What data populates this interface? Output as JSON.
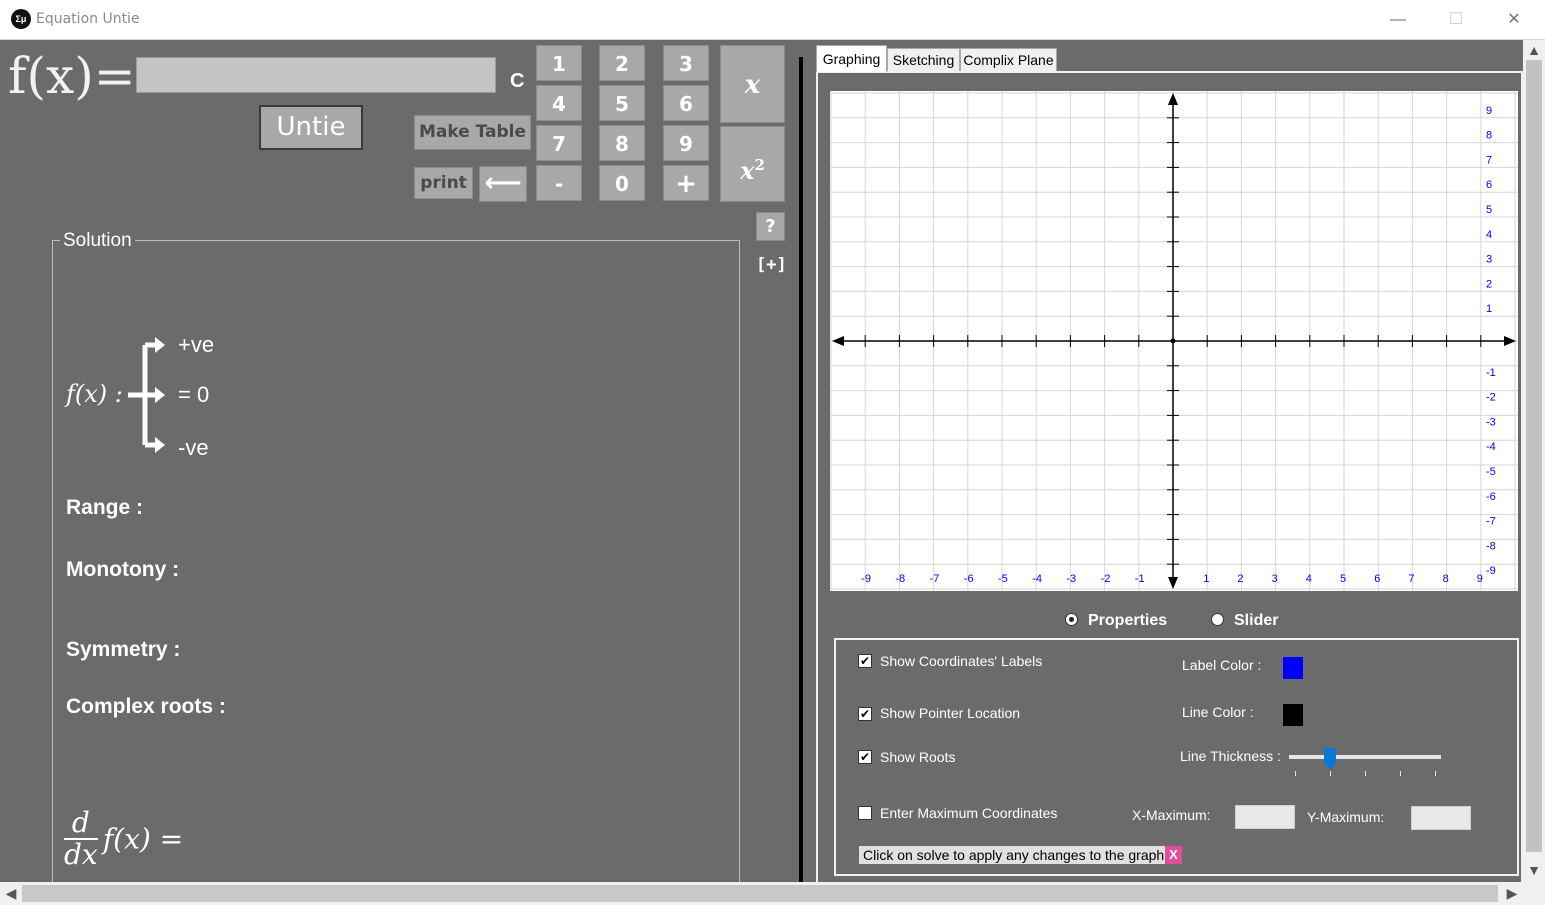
{
  "window": {
    "title": "Equation Untie",
    "icon": "app-logo-icon"
  },
  "input": {
    "fx_label": "f(x)=",
    "clear_label": "C",
    "value": ""
  },
  "keypad": {
    "keys": [
      "1",
      "2",
      "3",
      "4",
      "5",
      "6",
      "7",
      "8",
      "9",
      "-",
      "0",
      "+"
    ],
    "x_label": "x",
    "x2_label": "x",
    "x2_sup": "2",
    "help_label": "?",
    "expand_label": "[+]"
  },
  "buttons": {
    "untie": "Untie",
    "make_table": "Make Table",
    "print": "print",
    "backspace": "⟵"
  },
  "solution": {
    "title": "Solution",
    "fx_sign": "f(x) :",
    "positive": "+ve",
    "zero": "= 0",
    "negative": "-ve",
    "range": "Range :",
    "monotony": "Monotony :",
    "symmetry": "Symmetry :",
    "complex_roots": "Complex roots :",
    "derivative_top": "d",
    "derivative_bottom": "dx",
    "derivative_rest": "f(x) ="
  },
  "tabs": [
    "Graphing",
    "Sketching",
    "Complix Plane"
  ],
  "graph": {
    "x_ticks": [
      "-9",
      "-8",
      "-7",
      "-6",
      "-5",
      "-4",
      "-3",
      "-2",
      "-1",
      "1",
      "2",
      "3",
      "4",
      "5",
      "6",
      "7",
      "8",
      "9"
    ],
    "y_ticks": [
      "9",
      "8",
      "7",
      "6",
      "5",
      "4",
      "3",
      "2",
      "1",
      "-1",
      "-2",
      "-3",
      "-4",
      "-5",
      "-6",
      "-7",
      "-8",
      "-9"
    ],
    "label_color": "#0000ff"
  },
  "mode": {
    "properties": "Properties",
    "slider": "Slider",
    "selected": "Properties"
  },
  "properties": {
    "show_coords_labels": "Show Coordinates' Labels",
    "show_pointer": "Show Pointer Location",
    "show_roots": "Show Roots",
    "enter_max": "Enter Maximum Coordinates",
    "label_color": "Label Color :",
    "line_color": "Line Color :",
    "line_thickness": "Line Thickness :",
    "x_max": "X-Maximum:",
    "y_max": "Y-Maximum:",
    "label_color_value": "#0000ff",
    "line_color_value": "#000000",
    "hint": "Click on solve to apply any changes to the graph.",
    "hint_close": "X"
  },
  "checks": {
    "on": "✔"
  },
  "window_controls": {
    "minimize": "—",
    "maximize": "☐",
    "close": "✕"
  },
  "scroll": {
    "up": "▲",
    "down": "▼",
    "left": "◀",
    "right": "▶"
  }
}
